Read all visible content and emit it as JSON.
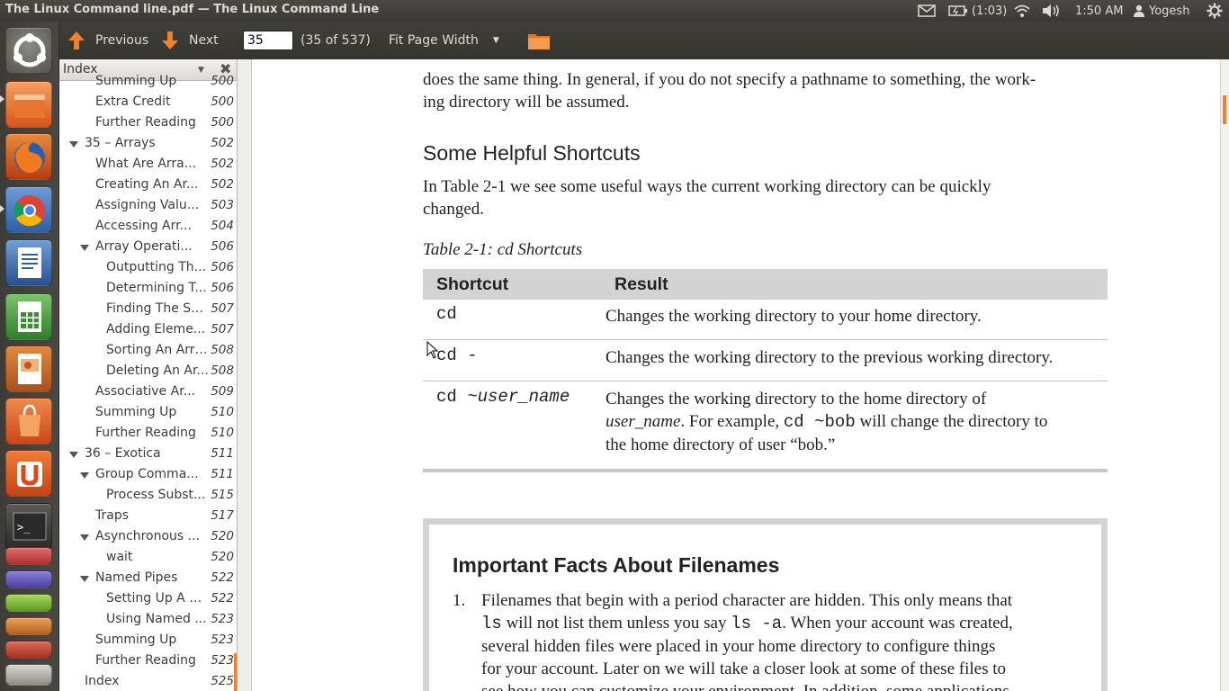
{
  "window": {
    "title": "The Linux Command line.pdf — The Linux Command Line"
  },
  "tray": {
    "battery": "(1:03)",
    "time": "1:50 AM",
    "user": "Yogesh"
  },
  "toolbar": {
    "previous_label": "Previous",
    "next_label": "Next",
    "page_value": "35",
    "page_count": "(35 of 537)",
    "zoom_label": "Fit Page Width"
  },
  "sidebar": {
    "header_label": "Index",
    "items": [
      {
        "title": "Summing Up",
        "page": "500",
        "level": 1,
        "expander": false
      },
      {
        "title": "Extra Credit",
        "page": "500",
        "level": 1,
        "expander": false
      },
      {
        "title": "Further Reading",
        "page": "500",
        "level": 1,
        "expander": false
      },
      {
        "title": "35 – Arrays",
        "page": "502",
        "level": 0,
        "expander": true
      },
      {
        "title": "What Are Arra...",
        "page": "502",
        "level": 1,
        "expander": false
      },
      {
        "title": "Creating An Ar...",
        "page": "502",
        "level": 1,
        "expander": false
      },
      {
        "title": "Assigning Valu...",
        "page": "503",
        "level": 1,
        "expander": false
      },
      {
        "title": "Accessing Arr...",
        "page": "504",
        "level": 1,
        "expander": false
      },
      {
        "title": "Array Operati...",
        "page": "506",
        "level": 1,
        "expander": true
      },
      {
        "title": "Outputting Th...",
        "page": "506",
        "level": 2,
        "expander": false
      },
      {
        "title": "Determining T...",
        "page": "506",
        "level": 2,
        "expander": false
      },
      {
        "title": "Finding The Su...",
        "page": "507",
        "level": 2,
        "expander": false
      },
      {
        "title": "Adding Eleme...",
        "page": "507",
        "level": 2,
        "expander": false
      },
      {
        "title": "Sorting An Array",
        "page": "508",
        "level": 2,
        "expander": false
      },
      {
        "title": "Deleting An Ar...",
        "page": "508",
        "level": 2,
        "expander": false
      },
      {
        "title": "Associative Ar...",
        "page": "509",
        "level": 1,
        "expander": false
      },
      {
        "title": "Summing Up",
        "page": "510",
        "level": 1,
        "expander": false
      },
      {
        "title": "Further Reading",
        "page": "510",
        "level": 1,
        "expander": false
      },
      {
        "title": "36 – Exotica",
        "page": "511",
        "level": 0,
        "expander": true
      },
      {
        "title": "Group Comma...",
        "page": "511",
        "level": 1,
        "expander": true
      },
      {
        "title": "Process Subst...",
        "page": "515",
        "level": 2,
        "expander": false
      },
      {
        "title": "Traps",
        "page": "517",
        "level": 1,
        "expander": false
      },
      {
        "title": "Asynchronous ...",
        "page": "520",
        "level": 1,
        "expander": true
      },
      {
        "title": "wait",
        "page": "520",
        "level": 2,
        "expander": false
      },
      {
        "title": "Named Pipes",
        "page": "522",
        "level": 1,
        "expander": true
      },
      {
        "title": "Setting Up A N...",
        "page": "522",
        "level": 2,
        "expander": false
      },
      {
        "title": "Using Named ...",
        "page": "523",
        "level": 2,
        "expander": false
      },
      {
        "title": "Summing Up",
        "page": "523",
        "level": 1,
        "expander": false
      },
      {
        "title": "Further Reading",
        "page": "523",
        "level": 1,
        "expander": false
      },
      {
        "title": "Index",
        "page": "525",
        "level": 0,
        "expander": false
      }
    ]
  },
  "document": {
    "para1_line1": "does the same thing. In general, if you do not specify a pathname to something, the work-",
    "para1_line2": "ing directory will be assumed.",
    "heading": "Some Helpful Shortcuts",
    "para2_line1": "In Table 2-1 we see some useful ways the current working directory can be quickly",
    "para2_line2": "changed.",
    "table_caption": "Table 2-1: cd Shortcuts",
    "table": {
      "col_shortcut": "Shortcut",
      "col_result": "Result",
      "row1_shortcut": "cd",
      "row1_result": "Changes the working directory to your home directory.",
      "row2_shortcut": "cd -",
      "row2_result": "Changes the working directory to the previous working directory.",
      "row3_shortcut_cmd": "cd ",
      "row3_shortcut_arg": "~user_name",
      "row3_result_a": "Changes the working directory to the home directory of",
      "row3_result_b_ital": "user_name",
      "row3_result_b_rest": ". For example, ",
      "row3_result_b_code": "cd ~bob",
      "row3_result_b_tail": " will change the directory to",
      "row3_result_c": "the home directory of user “bob.”"
    },
    "box_title": "Important Facts About Filenames",
    "box_item_num": "1.",
    "box_l1": "Filenames that begin with a period character are hidden. This only means that",
    "box_l2_code1": "ls",
    "box_l2_mid": " will not list them unless you say ",
    "box_l2_code2": "ls -a",
    "box_l2_tail": ". When your account was created,",
    "box_l3": "several hidden files were placed in your home directory to configure things",
    "box_l4": "for your account. Later on we will take a closer look at some of these files to",
    "box_l5": "see how you can customize your environment. In addition, some applications"
  }
}
